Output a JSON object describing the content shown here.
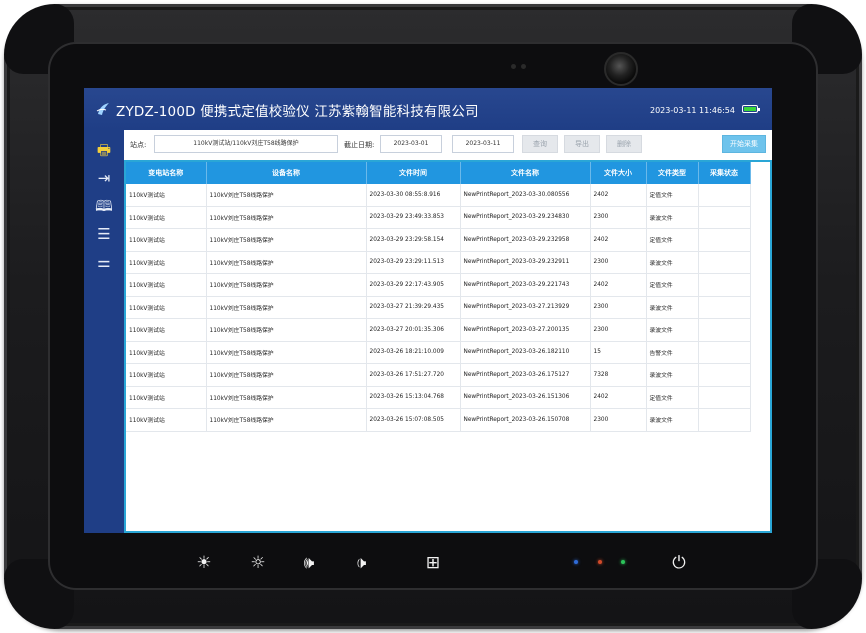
{
  "device": {
    "hardware_buttons": [
      {
        "name": "brightness-up-icon",
        "glyph": "☀"
      },
      {
        "name": "brightness-down-icon",
        "glyph": "☼"
      },
      {
        "name": "volume-up-icon",
        "glyph": "🕪"
      },
      {
        "name": "volume-down-icon",
        "glyph": "🕩"
      },
      {
        "name": "windows-icon",
        "glyph": "⊞"
      },
      {
        "name": "power-icon",
        "glyph": "⏻"
      }
    ],
    "led_colors": [
      "#2f6bd8",
      "#d04a2a",
      "#2cc35a"
    ]
  },
  "app": {
    "title": "ZYDZ-100D 便携式定值校验仪 江苏紫翰智能科技有限公司",
    "clock": "2023-03-11 11:46:54",
    "battery_color": "#3ad63a",
    "accent": "#2196e0"
  },
  "sidebar": [
    {
      "name": "printer-icon",
      "glyph": "🖶",
      "active": true
    },
    {
      "name": "import-icon",
      "glyph": "⇥"
    },
    {
      "name": "book-icon",
      "glyph": "🕮"
    },
    {
      "name": "server-icon",
      "glyph": "☰"
    },
    {
      "name": "settings-sliders-icon",
      "glyph": "⚌"
    }
  ],
  "toolbar": {
    "site_label": "站点:",
    "site_value": "110kV测试站/110kV刘庄T58线路保护",
    "date_label": "截止日期:",
    "date_from": "2023-03-01",
    "date_to": "2023-03-11",
    "query_label": "查询",
    "export_label": "导出",
    "delete_label": "删除",
    "start_label": "开始采集"
  },
  "table": {
    "columns": [
      "变电站名称",
      "设备名称",
      "文件时间",
      "文件名称",
      "文件大小",
      "文件类型",
      "采集状态"
    ],
    "rows": [
      [
        "110kV测试站",
        "110kV刘庄T58线路保护",
        "2023-03-30 08:55:8.916",
        "NewPrintReport_2023-03-30.080556",
        "2402",
        "定值文件",
        ""
      ],
      [
        "110kV测试站",
        "110kV刘庄T58线路保护",
        "2023-03-29 23:49:33.853",
        "NewPrintReport_2023-03-29.234830",
        "2300",
        "录波文件",
        ""
      ],
      [
        "110kV测试站",
        "110kV刘庄T58线路保护",
        "2023-03-29 23:29:58.154",
        "NewPrintReport_2023-03-29.232958",
        "2402",
        "定值文件",
        ""
      ],
      [
        "110kV测试站",
        "110kV刘庄T58线路保护",
        "2023-03-29 23:29:11.513",
        "NewPrintReport_2023-03-29.232911",
        "2300",
        "录波文件",
        ""
      ],
      [
        "110kV测试站",
        "110kV刘庄T58线路保护",
        "2023-03-29 22:17:43.905",
        "NewPrintReport_2023-03-29.221743",
        "2402",
        "定值文件",
        ""
      ],
      [
        "110kV测试站",
        "110kV刘庄T58线路保护",
        "2023-03-27 21:39:29.435",
        "NewPrintReport_2023-03-27.213929",
        "2300",
        "录波文件",
        ""
      ],
      [
        "110kV测试站",
        "110kV刘庄T58线路保护",
        "2023-03-27 20:01:35.306",
        "NewPrintReport_2023-03-27.200135",
        "2300",
        "录波文件",
        ""
      ],
      [
        "110kV测试站",
        "110kV刘庄T58线路保护",
        "2023-03-26 18:21:10.009",
        "NewPrintReport_2023-03-26.182110",
        "15",
        "告警文件",
        ""
      ],
      [
        "110kV测试站",
        "110kV刘庄T58线路保护",
        "2023-03-26 17:51:27.720",
        "NewPrintReport_2023-03-26.175127",
        "7328",
        "录波文件",
        ""
      ],
      [
        "110kV测试站",
        "110kV刘庄T58线路保护",
        "2023-03-26 15:13:04.768",
        "NewPrintReport_2023-03-26.151306",
        "2402",
        "定值文件",
        ""
      ],
      [
        "110kV测试站",
        "110kV刘庄T58线路保护",
        "2023-03-26 15:07:08.505",
        "NewPrintReport_2023-03-26.150708",
        "2300",
        "录波文件",
        ""
      ]
    ]
  }
}
